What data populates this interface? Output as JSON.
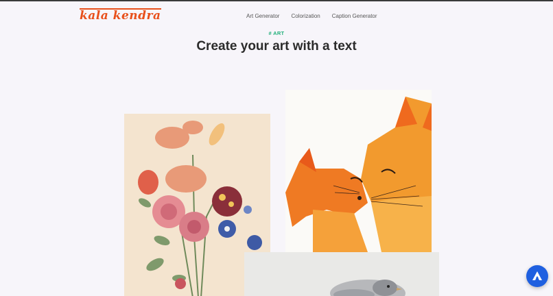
{
  "brand": {
    "logo_text": "kala kendra",
    "accent": "#e8501a"
  },
  "nav": {
    "items": [
      {
        "label": "Art Generator"
      },
      {
        "label": "Colorization"
      },
      {
        "label": "Caption Generator"
      }
    ]
  },
  "hero": {
    "tag": "# ART",
    "tag_color": "#21b07a",
    "title": "Create your art with a text"
  },
  "gallery": {
    "images": [
      {
        "subject": "botanical flower bouquet illustration"
      },
      {
        "subject": "watercolor foxes"
      },
      {
        "subject": "bird photo"
      }
    ]
  },
  "fab": {
    "icon": "app-logo-icon",
    "color": "#1f5fe0"
  }
}
